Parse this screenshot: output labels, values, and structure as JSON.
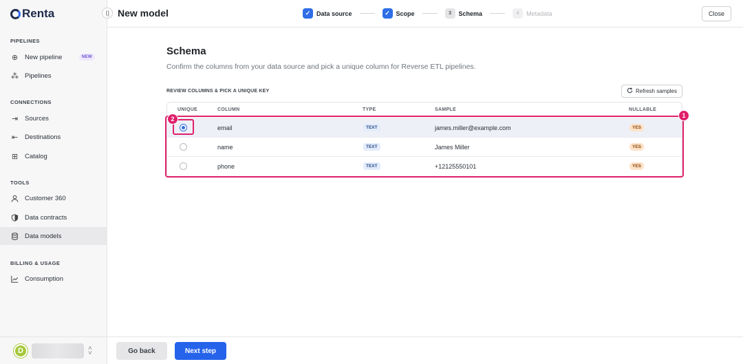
{
  "brand": {
    "name": "Renta"
  },
  "sidebar": {
    "sections": [
      {
        "title": "PIPELINES"
      },
      {
        "title": "CONNECTIONS"
      },
      {
        "title": "TOOLS"
      },
      {
        "title": "BILLING & USAGE"
      }
    ],
    "items": [
      {
        "label": "New pipeline",
        "icon": "plus-circle-icon",
        "badge": "NEW"
      },
      {
        "label": "Pipelines",
        "icon": "pipelines-icon"
      },
      {
        "label": "Sources",
        "icon": "source-arrow-icon"
      },
      {
        "label": "Destinations",
        "icon": "destination-arrow-icon"
      },
      {
        "label": "Catalog",
        "icon": "grid-icon"
      },
      {
        "label": "Customer 360",
        "icon": "user-icon"
      },
      {
        "label": "Data contracts",
        "icon": "shield-icon"
      },
      {
        "label": "Data models",
        "icon": "database-icon",
        "active": true
      },
      {
        "label": "Consumption",
        "icon": "chart-line-icon"
      }
    ],
    "user": {
      "avatar_letter": "D"
    }
  },
  "header": {
    "title": "New model",
    "steps": [
      {
        "label": "Data source",
        "state": "done"
      },
      {
        "label": "Scope",
        "state": "done"
      },
      {
        "label": "Schema",
        "number": "3",
        "state": "current"
      },
      {
        "label": "Metadata",
        "number": "4",
        "state": "future"
      }
    ],
    "close_label": "Close"
  },
  "main": {
    "title": "Schema",
    "subtitle": "Confirm the columns from your data source and pick a unique column for Reverse ETL pipelines.",
    "table_label": "REVIEW COLUMNS & PICK A UNIQUE KEY",
    "refresh_label": "Refresh samples",
    "columns": [
      "UNIQUE",
      "COLUMN",
      "TYPE",
      "SAMPLE",
      "NULLABLE"
    ],
    "rows": [
      {
        "column": "email",
        "type": "TEXT",
        "sample": "james.miller@example.com",
        "nullable": "YES",
        "unique": true
      },
      {
        "column": "name",
        "type": "TEXT",
        "sample": "James Miller",
        "nullable": "YES",
        "unique": false
      },
      {
        "column": "phone",
        "type": "TEXT",
        "sample": "+12125550101",
        "nullable": "YES",
        "unique": false
      }
    ]
  },
  "annotations": {
    "one": "1",
    "two": "2"
  },
  "footer": {
    "back_label": "Go back",
    "next_label": "Next step"
  },
  "colors": {
    "accent": "#2563eb",
    "annotation": "#e01f6a"
  }
}
